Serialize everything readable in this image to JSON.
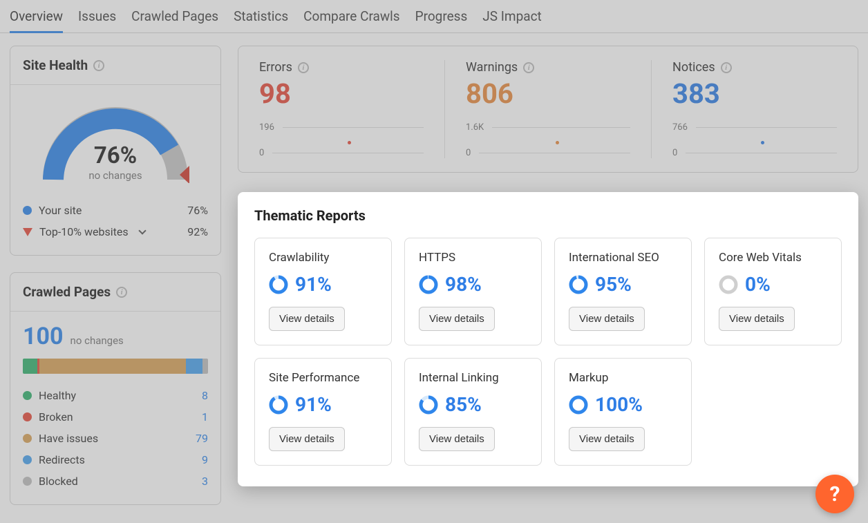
{
  "tabs": [
    "Overview",
    "Issues",
    "Crawled Pages",
    "Statistics",
    "Compare Crawls",
    "Progress",
    "JS Impact"
  ],
  "active_tab_index": 0,
  "site_health": {
    "title": "Site Health",
    "score": "76%",
    "sub": "no changes",
    "legend": {
      "your_site": {
        "label": "Your site",
        "value": "76%"
      },
      "top10": {
        "label": "Top-10% websites",
        "value": "92%"
      }
    },
    "colors": {
      "fill": "#2f86eb",
      "empty": "#c7c7c7",
      "arrow": "#d23b2f"
    }
  },
  "crawled_pages": {
    "title": "Crawled Pages",
    "count": "100",
    "sub": "no changes",
    "segments": [
      {
        "name": "Healthy",
        "value": 8,
        "color": "#34b26f"
      },
      {
        "name": "Broken",
        "value": 1,
        "color": "#e74c3c"
      },
      {
        "name": "Have issues",
        "value": 79,
        "color": "#d9a35a"
      },
      {
        "name": "Redirects",
        "value": 9,
        "color": "#4aa3ef"
      },
      {
        "name": "Blocked",
        "value": 3,
        "color": "#bfbfbf"
      }
    ]
  },
  "summary": {
    "errors": {
      "label": "Errors",
      "value": "98",
      "y_top": "196",
      "y_bot": "0",
      "dot_color": "#e74c3c"
    },
    "warnings": {
      "label": "Warnings",
      "value": "806",
      "y_top": "1.6K",
      "y_bot": "0",
      "dot_color": "#e88b3f"
    },
    "notices": {
      "label": "Notices",
      "value": "383",
      "y_top": "766",
      "y_bot": "0",
      "dot_color": "#2f7ee6"
    }
  },
  "thematic": {
    "title": "Thematic Reports",
    "view_label": "View details",
    "reports": [
      {
        "name": "Crawlability",
        "pct": 91,
        "display": "91%"
      },
      {
        "name": "HTTPS",
        "pct": 98,
        "display": "98%"
      },
      {
        "name": "International SEO",
        "pct": 95,
        "display": "95%"
      },
      {
        "name": "Core Web Vitals",
        "pct": 0,
        "display": "0%"
      },
      {
        "name": "Site Performance",
        "pct": 91,
        "display": "91%"
      },
      {
        "name": "Internal Linking",
        "pct": 85,
        "display": "85%"
      },
      {
        "name": "Markup",
        "pct": 100,
        "display": "100%"
      }
    ]
  },
  "help_glyph": "?"
}
